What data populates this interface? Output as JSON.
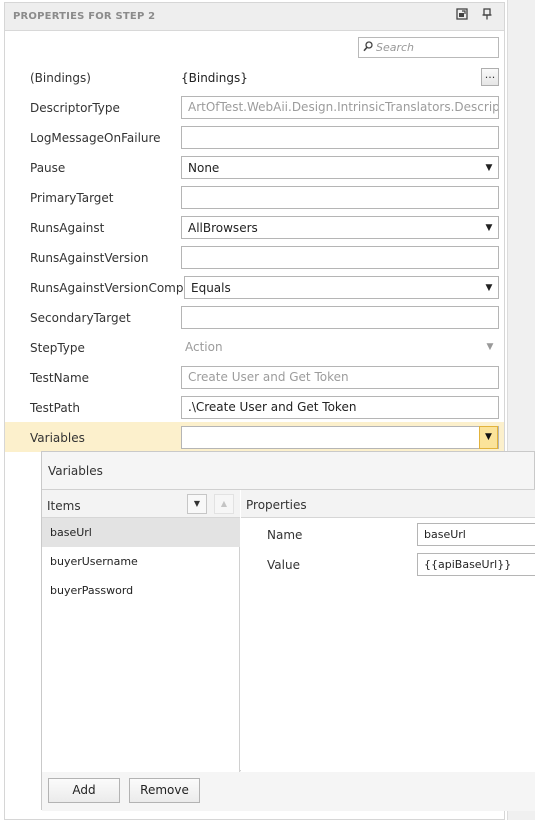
{
  "header": {
    "title": "PROPERTIES FOR STEP 2",
    "maximize_icon": "maximize-icon",
    "pin_icon": "pin-icon"
  },
  "search": {
    "placeholder": "Search",
    "icon": "search-icon"
  },
  "properties": [
    {
      "label": "(Bindings)",
      "value": "{Bindings}",
      "kind": "ellipsis"
    },
    {
      "label": "DescriptorType",
      "value": "ArtOfTest.WebAii.Design.IntrinsicTranslators.Descriptors.E",
      "kind": "readonly"
    },
    {
      "label": "LogMessageOnFailure",
      "value": "",
      "kind": "text"
    },
    {
      "label": "Pause",
      "value": "None",
      "kind": "combo"
    },
    {
      "label": "PrimaryTarget",
      "value": "",
      "kind": "text"
    },
    {
      "label": "RunsAgainst",
      "value": "AllBrowsers",
      "kind": "combo"
    },
    {
      "label": "RunsAgainstVersion",
      "value": "",
      "kind": "text"
    },
    {
      "label": "RunsAgainstVersionCompare",
      "value": "Equals",
      "kind": "combo"
    },
    {
      "label": "SecondaryTarget",
      "value": "",
      "kind": "text"
    },
    {
      "label": "StepType",
      "value": "Action",
      "kind": "disabled-combo"
    },
    {
      "label": "TestName",
      "value": "Create User and Get Token",
      "kind": "readonly"
    },
    {
      "label": "TestPath",
      "value": ".\\Create User and Get Token",
      "kind": "text"
    },
    {
      "label": "Variables",
      "value": "",
      "kind": "active-combo"
    }
  ],
  "variables_popup": {
    "title": "Variables",
    "items_header": "Items",
    "properties_header": "Properties",
    "items": [
      "baseUrl",
      "buyerUsername",
      "buyerPassword"
    ],
    "selected_item": "baseUrl",
    "fields": [
      {
        "label": "Name",
        "value": "baseUrl"
      },
      {
        "label": "Value",
        "value": "{{apiBaseUrl}}"
      }
    ],
    "add_label": "Add",
    "remove_label": "Remove"
  },
  "colors": {
    "selected_row": "#fcf0cc",
    "header_bg": "#eeeeee",
    "dropdown_active": "#fbe39a"
  }
}
